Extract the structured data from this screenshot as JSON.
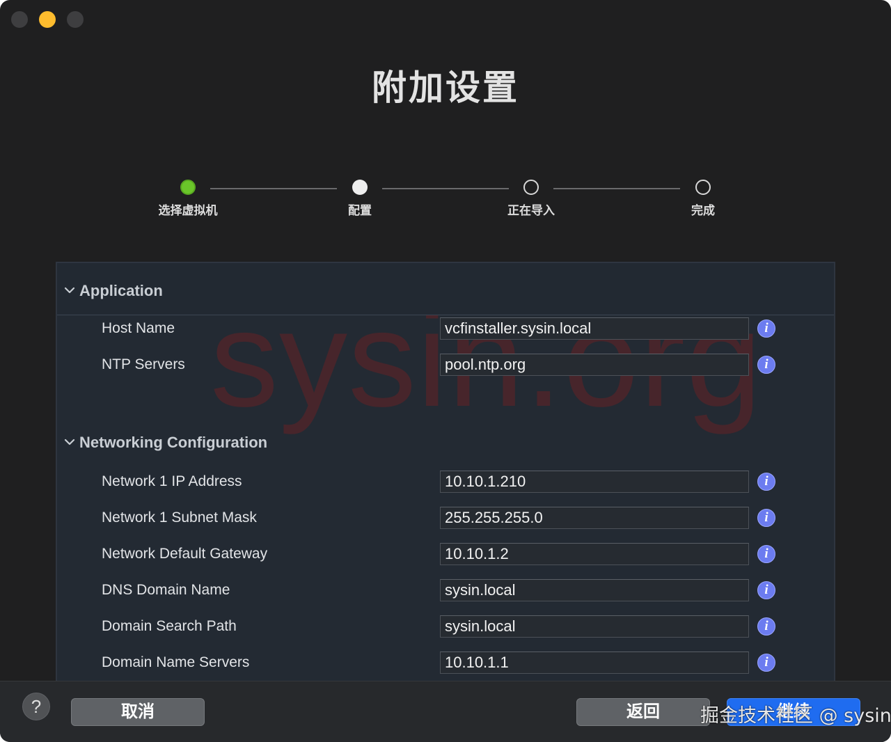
{
  "window": {
    "title": "附加设置"
  },
  "steps": [
    {
      "label": "选择虚拟机",
      "state": "done"
    },
    {
      "label": "配置",
      "state": "current"
    },
    {
      "label": "正在导入",
      "state": "todo"
    },
    {
      "label": "完成",
      "state": "todo"
    }
  ],
  "watermark": "sysin.org",
  "application": {
    "title": "Application",
    "rows": [
      {
        "label": "Host Name",
        "value": "vcfinstaller.sysin.local"
      },
      {
        "label": "NTP Servers",
        "value": "pool.ntp.org"
      }
    ]
  },
  "networking": {
    "title": "Networking Configuration",
    "rows": [
      {
        "label": "Network 1 IP Address",
        "value": "10.10.1.210"
      },
      {
        "label": "Network 1 Subnet Mask",
        "value": "255.255.255.0"
      },
      {
        "label": "Network Default Gateway",
        "value": "10.10.1.2"
      },
      {
        "label": "DNS Domain Name",
        "value": "sysin.local"
      },
      {
        "label": "Domain Search Path",
        "value": "sysin.local"
      },
      {
        "label": "Domain Name Servers",
        "value": "10.10.1.1"
      }
    ]
  },
  "info_glyph": "i",
  "footer": {
    "help": "?",
    "cancel": "取消",
    "back": "返回",
    "continue": "继续"
  },
  "corner_watermark": "掘金技术社区 @ sysin",
  "colors": {
    "step_done": "#6ac52a",
    "primary_button": "#1f6cf0",
    "info_icon": "#6c7cf0",
    "minimize_light": "#febc2e"
  }
}
